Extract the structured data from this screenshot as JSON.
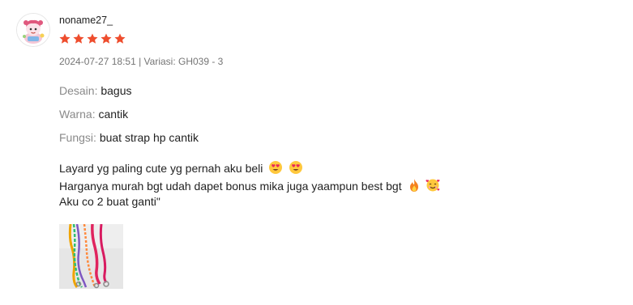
{
  "review": {
    "username": "noname27_",
    "rating": 5,
    "rating_max": 5,
    "star_color": "#ee4d2d",
    "meta": "2024-07-27 18:51 | Variasi: GH039 - 3",
    "attributes": [
      {
        "key": "Desain:",
        "value": "bagus"
      },
      {
        "key": "Warna:",
        "value": "cantik"
      },
      {
        "key": "Fungsi:",
        "value": "buat strap hp cantik"
      }
    ],
    "lines": [
      "Layard yg paling cute yg pernah aku beli",
      "Harganya murah bgt udah dapet bonus mika juga yaampun best bgt",
      "Aku co 2 buat ganti\""
    ],
    "line_emojis": [
      [
        "heart-eyes-emoji",
        "heart-eyes-emoji"
      ],
      [
        "fire-emoji",
        "smiling-face-with-hearts-emoji"
      ],
      []
    ],
    "avatar_icon": "cartoon-avatar-icon",
    "media": [
      {
        "icon": "lanyard-photo"
      }
    ]
  }
}
